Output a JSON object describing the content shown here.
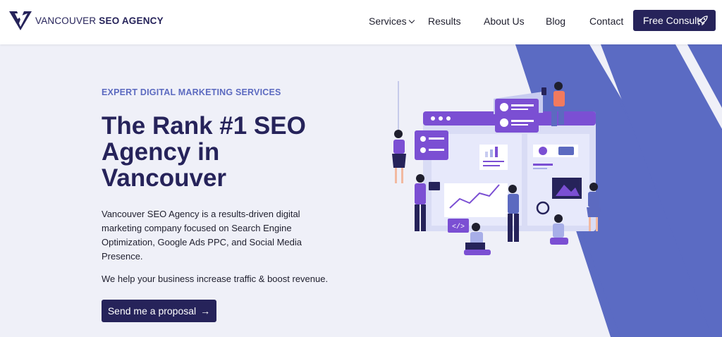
{
  "header": {
    "brand_thin": "VANCOUVER",
    "brand_bold": " SEO AGENCY",
    "nav": [
      {
        "label": "Services"
      },
      {
        "label": "Results"
      },
      {
        "label": "About Us"
      },
      {
        "label": "Blog"
      },
      {
        "label": "Contact"
      }
    ],
    "cta_label": "Free Consult"
  },
  "hero": {
    "kicker": "EXPERT DIGITAL MARKETING SERVICES",
    "title": "The Rank #1 SEO Agency in Vancouver",
    "description": "Vancouver SEO Agency is a results-driven digital marketing company focused on Search Engine Optimization, Google Ads PPC, and Social Media Presence.",
    "description2": "We help your business increase traffic & boost revenue.",
    "button_label": "Send me a proposal",
    "button_arrow": "→"
  },
  "colors": {
    "navy": "#26235a",
    "accent": "#5c6ac0",
    "stripe": "#5b6bc3",
    "purple": "#7b4fd3",
    "background": "#eff0f8"
  },
  "icons": [
    "logo-mark-icon",
    "chevron-down-icon",
    "rocket-icon",
    "arrow-right-icon"
  ]
}
